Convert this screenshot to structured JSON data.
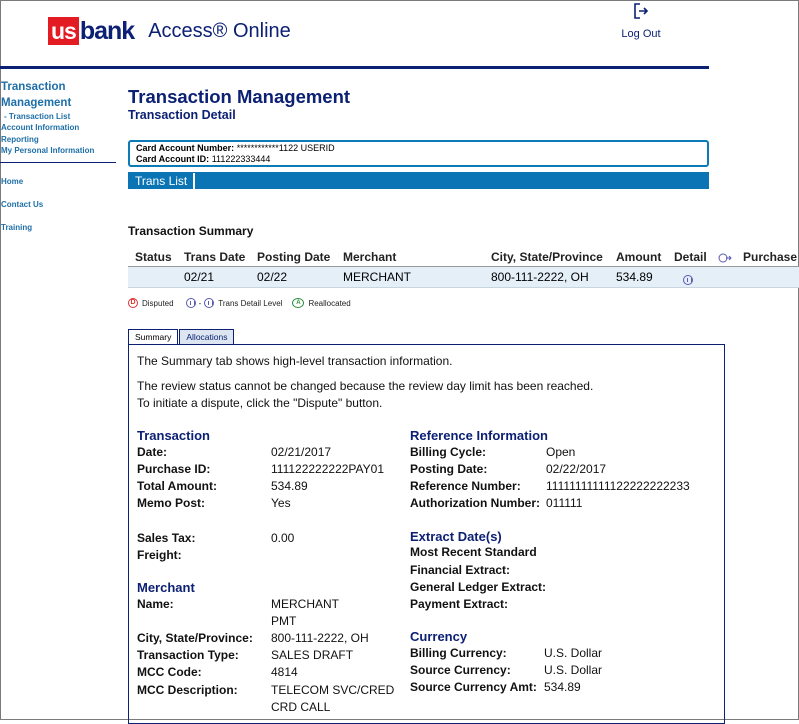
{
  "header": {
    "logo_us": "us",
    "logo_bank": "bank",
    "logo_product": "Access® Online",
    "logout_label": "Log Out"
  },
  "leftnav": {
    "title": "Transaction Management",
    "sub_item": "- Transaction List",
    "items": [
      "Account Information",
      "Reporting",
      "My Personal Information"
    ],
    "links": [
      "Home",
      "Contact Us",
      "Training"
    ]
  },
  "page": {
    "title": "Transaction Management",
    "subtitle": "Transaction Detail"
  },
  "account": {
    "number_label": "Card Account Number:",
    "number_value": "************1122 USERID",
    "id_label": "Card Account ID:",
    "id_value": "111222333444"
  },
  "trans_list_tab": "Trans List",
  "summary": {
    "heading": "Transaction Summary",
    "columns": [
      "Status",
      "Trans Date",
      "Posting Date",
      "Merchant",
      "City, State/Province",
      "Amount",
      "Detail",
      "Purchase"
    ],
    "row": {
      "status": "",
      "trans_date": "02/21",
      "posting_date": "02/22",
      "merchant": "MERCHANT",
      "city": "800-111-2222, OH",
      "amount": "534.89"
    }
  },
  "legend": {
    "disputed": "Disputed",
    "detail_level": "Trans Detail Level",
    "reallocated": "Reallocated"
  },
  "tabs": [
    "Summary",
    "Allocations"
  ],
  "panel": {
    "intro": "The Summary tab shows high-level transaction information.",
    "notice_1": "The review status cannot be changed because the review day limit has been reached.",
    "notice_2": "To initiate a dispute, click the \"Dispute\" button.",
    "transaction": {
      "title": "Transaction",
      "date_label": "Date:",
      "date": "02/21/2017",
      "purchase_id_label": "Purchase ID:",
      "purchase_id": "111122222222PAY01",
      "total_label": "Total Amount:",
      "total": "534.89",
      "memo_label": "Memo Post:",
      "memo": "Yes",
      "sales_tax_label": "Sales Tax:",
      "sales_tax": "0.00",
      "freight_label": "Freight:"
    },
    "reference": {
      "title": "Reference Information",
      "billing_cycle_label": "Billing Cycle:",
      "billing_cycle": "Open",
      "posting_date_label": "Posting Date:",
      "posting_date": "02/22/2017",
      "ref_number_label": "Reference Number:",
      "ref_number": "11111111111122222222233",
      "auth_label": "Authorization Number:",
      "auth": "011111"
    },
    "extract": {
      "title": "Extract Date(s)",
      "recent": "Most Recent Standard",
      "financial": "Financial Extract:",
      "general_ledger": "General Ledger Extract:",
      "payment": "Payment Extract:"
    },
    "merchant": {
      "title": "Merchant",
      "name_label": "Name:",
      "name_1": "MERCHANT",
      "name_2": "PMT",
      "city_label": "City, State/Province:",
      "city": "800-111-2222, OH",
      "type_label": "Transaction Type:",
      "type": "SALES DRAFT",
      "mcc_label": "MCC Code:",
      "mcc": "4814",
      "mcc_desc_label": "MCC Description:",
      "mcc_desc_1": "TELECOM SVC/CRED",
      "mcc_desc_2": "CRD CALL"
    },
    "currency": {
      "title": "Currency",
      "billing_label": "Billing Currency:",
      "billing": "U.S. Dollar",
      "source_label": "Source Currency:",
      "source": "U.S. Dollar",
      "source_amt_label": "Source Currency Amt:",
      "source_amt": "534.89"
    }
  }
}
